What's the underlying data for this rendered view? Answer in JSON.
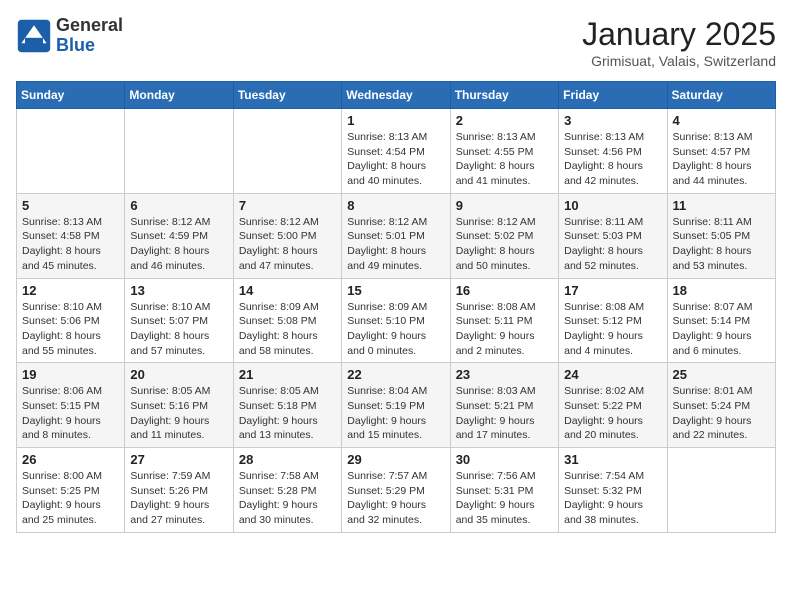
{
  "header": {
    "logo_general": "General",
    "logo_blue": "Blue",
    "month_title": "January 2025",
    "location": "Grimisuat, Valais, Switzerland"
  },
  "days_of_week": [
    "Sunday",
    "Monday",
    "Tuesday",
    "Wednesday",
    "Thursday",
    "Friday",
    "Saturday"
  ],
  "weeks": [
    [
      {
        "day": "",
        "info": ""
      },
      {
        "day": "",
        "info": ""
      },
      {
        "day": "",
        "info": ""
      },
      {
        "day": "1",
        "info": "Sunrise: 8:13 AM\nSunset: 4:54 PM\nDaylight: 8 hours\nand 40 minutes."
      },
      {
        "day": "2",
        "info": "Sunrise: 8:13 AM\nSunset: 4:55 PM\nDaylight: 8 hours\nand 41 minutes."
      },
      {
        "day": "3",
        "info": "Sunrise: 8:13 AM\nSunset: 4:56 PM\nDaylight: 8 hours\nand 42 minutes."
      },
      {
        "day": "4",
        "info": "Sunrise: 8:13 AM\nSunset: 4:57 PM\nDaylight: 8 hours\nand 44 minutes."
      }
    ],
    [
      {
        "day": "5",
        "info": "Sunrise: 8:13 AM\nSunset: 4:58 PM\nDaylight: 8 hours\nand 45 minutes."
      },
      {
        "day": "6",
        "info": "Sunrise: 8:12 AM\nSunset: 4:59 PM\nDaylight: 8 hours\nand 46 minutes."
      },
      {
        "day": "7",
        "info": "Sunrise: 8:12 AM\nSunset: 5:00 PM\nDaylight: 8 hours\nand 47 minutes."
      },
      {
        "day": "8",
        "info": "Sunrise: 8:12 AM\nSunset: 5:01 PM\nDaylight: 8 hours\nand 49 minutes."
      },
      {
        "day": "9",
        "info": "Sunrise: 8:12 AM\nSunset: 5:02 PM\nDaylight: 8 hours\nand 50 minutes."
      },
      {
        "day": "10",
        "info": "Sunrise: 8:11 AM\nSunset: 5:03 PM\nDaylight: 8 hours\nand 52 minutes."
      },
      {
        "day": "11",
        "info": "Sunrise: 8:11 AM\nSunset: 5:05 PM\nDaylight: 8 hours\nand 53 minutes."
      }
    ],
    [
      {
        "day": "12",
        "info": "Sunrise: 8:10 AM\nSunset: 5:06 PM\nDaylight: 8 hours\nand 55 minutes."
      },
      {
        "day": "13",
        "info": "Sunrise: 8:10 AM\nSunset: 5:07 PM\nDaylight: 8 hours\nand 57 minutes."
      },
      {
        "day": "14",
        "info": "Sunrise: 8:09 AM\nSunset: 5:08 PM\nDaylight: 8 hours\nand 58 minutes."
      },
      {
        "day": "15",
        "info": "Sunrise: 8:09 AM\nSunset: 5:10 PM\nDaylight: 9 hours\nand 0 minutes."
      },
      {
        "day": "16",
        "info": "Sunrise: 8:08 AM\nSunset: 5:11 PM\nDaylight: 9 hours\nand 2 minutes."
      },
      {
        "day": "17",
        "info": "Sunrise: 8:08 AM\nSunset: 5:12 PM\nDaylight: 9 hours\nand 4 minutes."
      },
      {
        "day": "18",
        "info": "Sunrise: 8:07 AM\nSunset: 5:14 PM\nDaylight: 9 hours\nand 6 minutes."
      }
    ],
    [
      {
        "day": "19",
        "info": "Sunrise: 8:06 AM\nSunset: 5:15 PM\nDaylight: 9 hours\nand 8 minutes."
      },
      {
        "day": "20",
        "info": "Sunrise: 8:05 AM\nSunset: 5:16 PM\nDaylight: 9 hours\nand 11 minutes."
      },
      {
        "day": "21",
        "info": "Sunrise: 8:05 AM\nSunset: 5:18 PM\nDaylight: 9 hours\nand 13 minutes."
      },
      {
        "day": "22",
        "info": "Sunrise: 8:04 AM\nSunset: 5:19 PM\nDaylight: 9 hours\nand 15 minutes."
      },
      {
        "day": "23",
        "info": "Sunrise: 8:03 AM\nSunset: 5:21 PM\nDaylight: 9 hours\nand 17 minutes."
      },
      {
        "day": "24",
        "info": "Sunrise: 8:02 AM\nSunset: 5:22 PM\nDaylight: 9 hours\nand 20 minutes."
      },
      {
        "day": "25",
        "info": "Sunrise: 8:01 AM\nSunset: 5:24 PM\nDaylight: 9 hours\nand 22 minutes."
      }
    ],
    [
      {
        "day": "26",
        "info": "Sunrise: 8:00 AM\nSunset: 5:25 PM\nDaylight: 9 hours\nand 25 minutes."
      },
      {
        "day": "27",
        "info": "Sunrise: 7:59 AM\nSunset: 5:26 PM\nDaylight: 9 hours\nand 27 minutes."
      },
      {
        "day": "28",
        "info": "Sunrise: 7:58 AM\nSunset: 5:28 PM\nDaylight: 9 hours\nand 30 minutes."
      },
      {
        "day": "29",
        "info": "Sunrise: 7:57 AM\nSunset: 5:29 PM\nDaylight: 9 hours\nand 32 minutes."
      },
      {
        "day": "30",
        "info": "Sunrise: 7:56 AM\nSunset: 5:31 PM\nDaylight: 9 hours\nand 35 minutes."
      },
      {
        "day": "31",
        "info": "Sunrise: 7:54 AM\nSunset: 5:32 PM\nDaylight: 9 hours\nand 38 minutes."
      },
      {
        "day": "",
        "info": ""
      }
    ]
  ]
}
